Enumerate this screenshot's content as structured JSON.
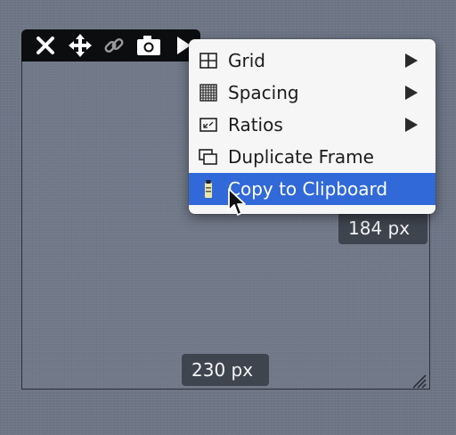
{
  "toolbar": {
    "buttons": [
      {
        "name": "close-icon"
      },
      {
        "name": "move-icon"
      },
      {
        "name": "link-icon"
      },
      {
        "name": "camera-icon"
      },
      {
        "name": "play-arrow-icon"
      }
    ]
  },
  "dimensions": {
    "height_label": "184 px",
    "width_label": "230 px"
  },
  "context_menu": {
    "items": [
      {
        "label": "Grid",
        "icon": "grid-icon",
        "has_submenu": true
      },
      {
        "label": "Spacing",
        "icon": "spacing-icon",
        "has_submenu": true
      },
      {
        "label": "Ratios",
        "icon": "ratios-icon",
        "has_submenu": true
      },
      {
        "label": "Duplicate Frame",
        "icon": "duplicate-frame-icon",
        "has_submenu": false
      },
      {
        "label": "Copy to Clipboard",
        "icon": "clipboard-icon",
        "has_submenu": false,
        "highlighted": true
      }
    ]
  },
  "colors": {
    "highlight": "#3169d8",
    "toolbar_bg": "#0c0d0f",
    "badge_bg": "#3f454f",
    "desktop_bg": "#6e7686"
  }
}
